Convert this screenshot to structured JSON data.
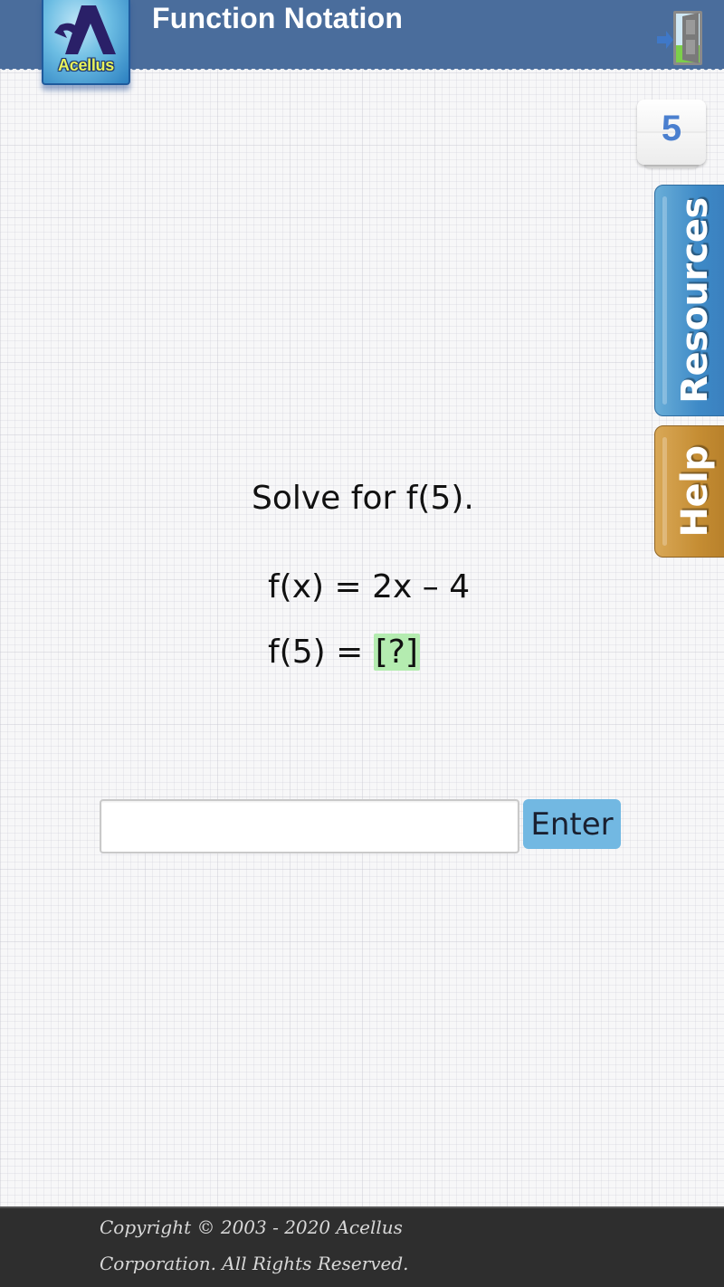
{
  "header": {
    "title": "Function Notation",
    "logo_text": "Acellus",
    "exit_icon": "exit-door-icon"
  },
  "counter": {
    "value": "5"
  },
  "side_tabs": {
    "resources": "Resources",
    "help": "Help"
  },
  "question": {
    "prompt": "Solve for f(5).",
    "equation": "f(x) = 2x – 4",
    "answer_prefix": "f(5) = ",
    "blank": "[?]"
  },
  "answer": {
    "value": "",
    "placeholder": "",
    "enter_label": "Enter"
  },
  "footer": {
    "line1": "Copyright © 2003 - 2020 Acellus",
    "line2": "Corporation.  All Rights Reserved."
  },
  "colors": {
    "header": "#4a6d9c",
    "resources_tab": "#3e8ac7",
    "help_tab": "#c58d33",
    "enter_button": "#72b8e2",
    "blank_highlight": "#b4ecb0",
    "footer": "#2e2e2e"
  }
}
